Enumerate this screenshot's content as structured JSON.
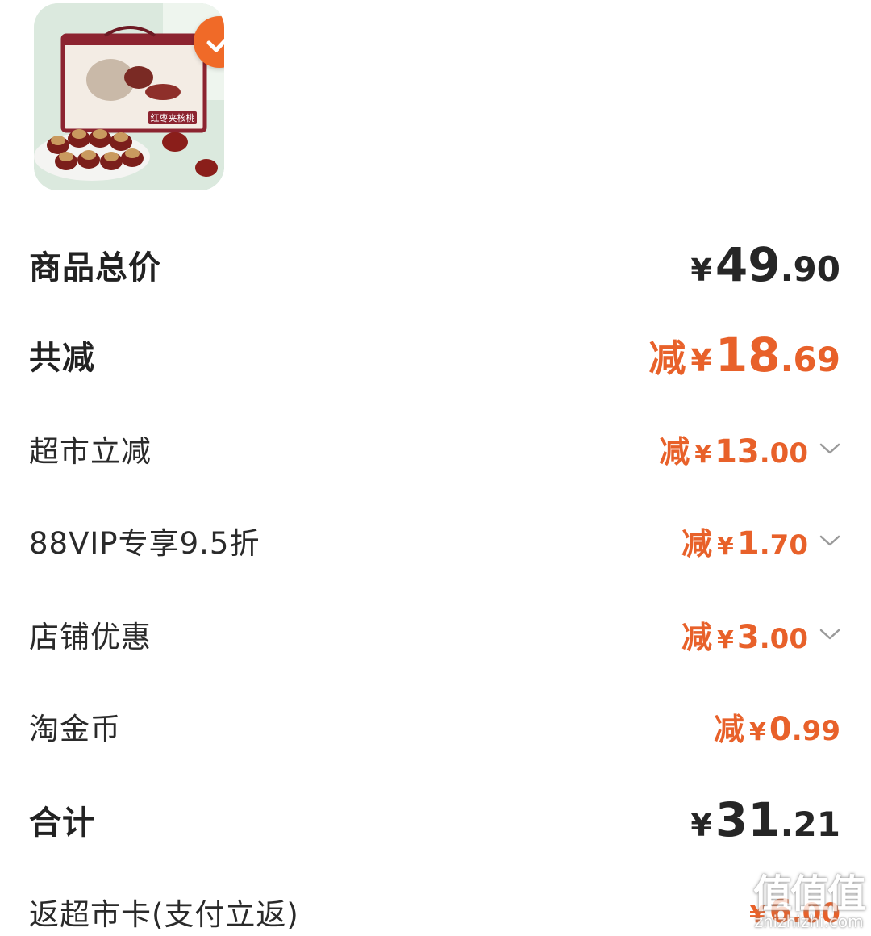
{
  "product": {
    "image_icon": "product-thumbnail-red-dates-walnut",
    "package_text": "红枣夹核桃",
    "selected_icon": "check-icon",
    "badge_color": "#f06a28"
  },
  "summary": {
    "total_price": {
      "label": "商品总价",
      "currency": "¥",
      "integer": "49",
      "decimal": ".90"
    },
    "total_discount": {
      "label": "共减",
      "prefix": "减",
      "currency": "¥",
      "integer": "18",
      "decimal": ".69"
    },
    "discounts": [
      {
        "label": "超市立减",
        "prefix": "减",
        "currency": "¥",
        "integer": "13",
        "decimal": ".00",
        "expandable": true
      },
      {
        "label": "88VIP专享9.5折",
        "prefix": "减",
        "currency": "¥",
        "integer": "1",
        "decimal": ".70",
        "expandable": true
      },
      {
        "label": "店铺优惠",
        "prefix": "减",
        "currency": "¥",
        "integer": "3",
        "decimal": ".00",
        "expandable": true
      },
      {
        "label": "淘金币",
        "prefix": "减",
        "currency": "¥",
        "integer": "0",
        "decimal": ".99",
        "expandable": false
      }
    ],
    "subtotal": {
      "label": "合计",
      "currency": "¥",
      "integer": "31",
      "decimal": ".21"
    },
    "cashback": {
      "label": "返超市卡(支付立返)",
      "currency": "¥",
      "integer": "6",
      "decimal": ".00"
    }
  },
  "watermark": {
    "logo": "值值值",
    "url": "zhizhizhi.com"
  },
  "colors": {
    "accent_orange": "#e8612a",
    "text_dark": "#222222",
    "chevron": "#9a9a9a"
  }
}
